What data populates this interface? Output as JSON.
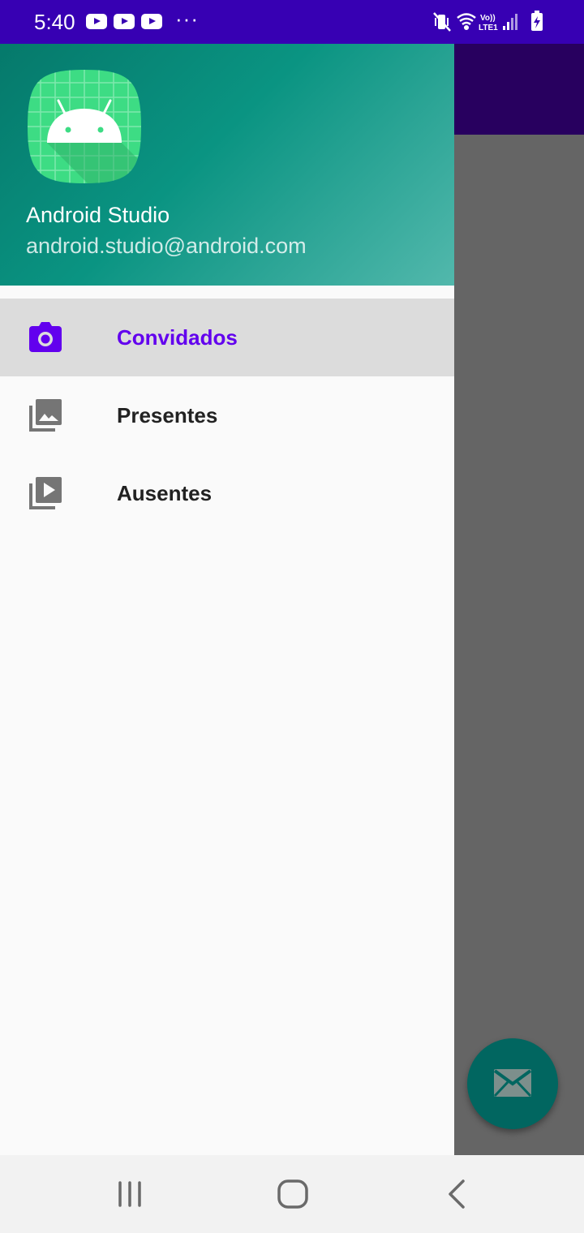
{
  "status_bar": {
    "time": "5:40",
    "notification_icons": [
      "youtube-icon",
      "youtube-icon",
      "youtube-icon"
    ],
    "overflow": "···",
    "network_label_top": "Vo))",
    "network_label_bottom": "LTE1",
    "right_icons": [
      "mute-vibrate-icon",
      "wifi-icon",
      "volte-lte-icon",
      "signal-icon",
      "battery-charging-icon"
    ]
  },
  "drawer": {
    "header": {
      "avatar_icon": "android-icon",
      "name": "Android Studio",
      "email": "android.studio@android.com"
    },
    "items": [
      {
        "label": "Convidados",
        "icon": "camera-icon",
        "selected": true
      },
      {
        "label": "Presentes",
        "icon": "gallery-icon",
        "selected": false
      },
      {
        "label": "Ausentes",
        "icon": "video-library-icon",
        "selected": false
      }
    ]
  },
  "fab": {
    "icon": "mail-icon"
  },
  "nav_bar": {
    "buttons": [
      "recents-icon",
      "home-icon",
      "back-icon"
    ]
  },
  "colors": {
    "status_bar": "#3700b3",
    "toolbar": "#28005f",
    "accent": "#6200ee",
    "fab": "#016660",
    "header_start": "#05796b",
    "header_end": "#52b8ac"
  }
}
